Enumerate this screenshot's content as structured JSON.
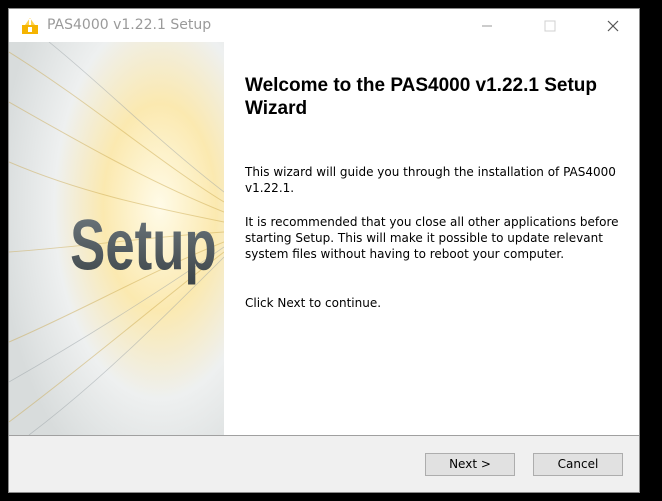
{
  "window": {
    "title": "PAS4000 v1.22.1 Setup",
    "icons": {
      "app": "installer-icon",
      "minimize": "minimize-icon",
      "maximize": "maximize-icon",
      "close": "close-icon"
    }
  },
  "banner": {
    "word": "Setup"
  },
  "content": {
    "heading": "Welcome to the PAS4000 v1.22.1 Setup Wizard",
    "paragraphs": [
      "This wizard will guide you through the installation of PAS4000 v1.22.1.",
      "It is recommended that you close all other applications before starting Setup. This will make it possible to update relevant system files without having to reboot your computer.",
      "Click Next to continue."
    ]
  },
  "buttons": {
    "next": "Next >",
    "cancel": "Cancel"
  },
  "colors": {
    "accent": "#f5b400",
    "title_text": "#9a9a9a",
    "button_face": "#e1e1e1"
  }
}
